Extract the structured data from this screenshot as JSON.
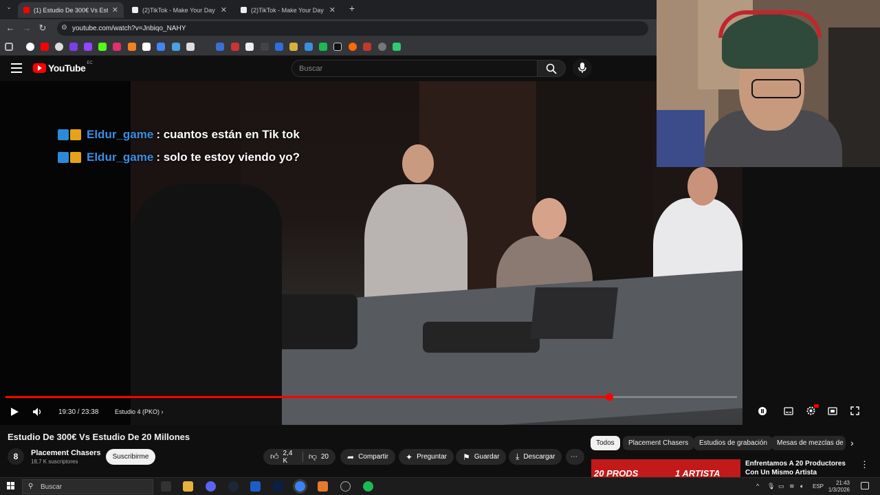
{
  "browser": {
    "tabs": [
      {
        "title": "(1) Estudio De 300€ Vs Estudio",
        "favicon_color": "#ff0000",
        "active": true
      },
      {
        "title": "(2)TikTok - Make Your Day",
        "favicon_color": "#ffffff",
        "active": false
      },
      {
        "title": "(2)TikTok - Make Your Day",
        "favicon_color": "#ffffff",
        "active": false
      }
    ],
    "new_tab": "+",
    "url": "youtube.com/watch?v=Jnbiqo_NAHY"
  },
  "youtube": {
    "logo_text": "YouTube",
    "country_code": "EC",
    "search_placeholder": "Buscar"
  },
  "player": {
    "current_time": "19:30",
    "duration": "23:38",
    "time_display": "19:30 / 23:38",
    "chapter": "Estudio 4 (PKO)",
    "progress_fraction": 0.825
  },
  "chat_overlay": [
    {
      "user": "Eldur_game",
      "message": ": cuantos están en Tik tok"
    },
    {
      "user": "Eldur_game",
      "message": ": solo te estoy viendo yo?"
    }
  ],
  "video": {
    "title": "Estudio De 300€ Vs Estudio De 20 Millones",
    "channel": "Placement Chasers",
    "subscribers": "18,7 K suscriptores",
    "subscribe_label": "Suscribirme",
    "likes": "2,4 K",
    "dislikes": "20",
    "share_label": "Compartir",
    "ask_label": "Preguntar",
    "save_label": "Guardar",
    "download_label": "Descargar"
  },
  "recommendations": {
    "chips": [
      "Todos",
      "Placement Chasers",
      "Estudios de grabación",
      "Mesas de mezclas de"
    ],
    "first": {
      "thumb_text_left": "20 PRODS",
      "thumb_text_right": "1 ARTISTA",
      "title": "Enfrentamos A 20 Productores Con Un Mismo Artista"
    }
  },
  "taskbar": {
    "search_placeholder": "Buscar",
    "language": "ESP",
    "time": "21:43",
    "date": "1/3/2026"
  }
}
